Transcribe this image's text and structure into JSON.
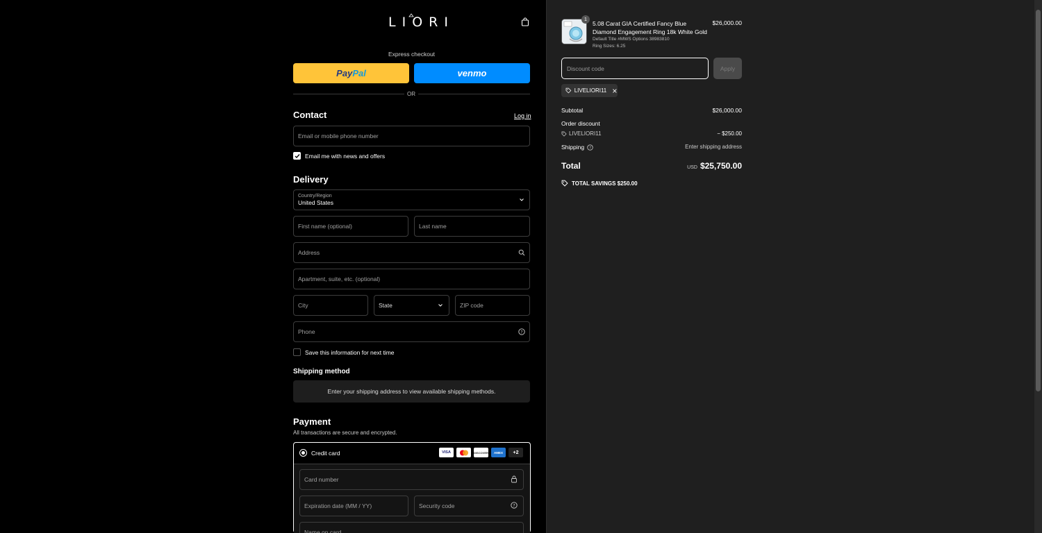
{
  "header": {
    "logo": "LIORI"
  },
  "express": {
    "label": "Express checkout",
    "paypal_a": "Pay",
    "paypal_b": "Pal",
    "venmo": "venmo",
    "or": "OR"
  },
  "contact": {
    "title": "Contact",
    "login": "Log in",
    "email_placeholder": "Email or mobile phone number",
    "newsletter_label": "Email me with news and offers"
  },
  "delivery": {
    "title": "Delivery",
    "country_label": "Country/Region",
    "country_value": "United States",
    "first_name": "First name (optional)",
    "last_name": "Last name",
    "address": "Address",
    "apartment": "Apartment, suite, etc. (optional)",
    "city": "City",
    "state": "State",
    "zip": "ZIP code",
    "phone": "Phone",
    "save_info": "Save this information for next time"
  },
  "shipping_method": {
    "title": "Shipping method",
    "message": "Enter your shipping address to view available shipping methods."
  },
  "payment": {
    "title": "Payment",
    "subtitle": "All transactions are secure and encrypted.",
    "credit_card": "Credit card",
    "more_cards": "+2",
    "card_logos": [
      "VISA",
      "MC",
      "DISCOVER",
      "AMEX"
    ],
    "card_number": "Card number",
    "expiration": "Expiration date (MM / YY)",
    "security": "Security code",
    "name_on_card": "Name on card"
  },
  "order": {
    "quantity": "1",
    "product_title": "5.08 Carat GIA Certified Fancy Blue Diamond Engagement Ring 18k White Gold",
    "product_variant": "Default Title #MWS Options 38983810",
    "product_size": "Ring Sizes: 6.25",
    "product_price": "$26,000.00",
    "discount_placeholder": "Discount code",
    "apply": "Apply",
    "applied_code": "LIVELIORI11",
    "subtotal_label": "Subtotal",
    "subtotal_value": "$26,000.00",
    "order_discount_label": "Order discount",
    "discount_code": "LIVELIORI11",
    "discount_value": "− $250.00",
    "shipping_label": "Shipping",
    "shipping_value": "Enter shipping address",
    "total_label": "Total",
    "currency": "USD",
    "total_value": "$25,750.00",
    "savings": "TOTAL SAVINGS  $250.00"
  },
  "colors": {
    "paypal": "#ffc439",
    "venmo": "#008cff",
    "panel": "#1f1f1f"
  }
}
